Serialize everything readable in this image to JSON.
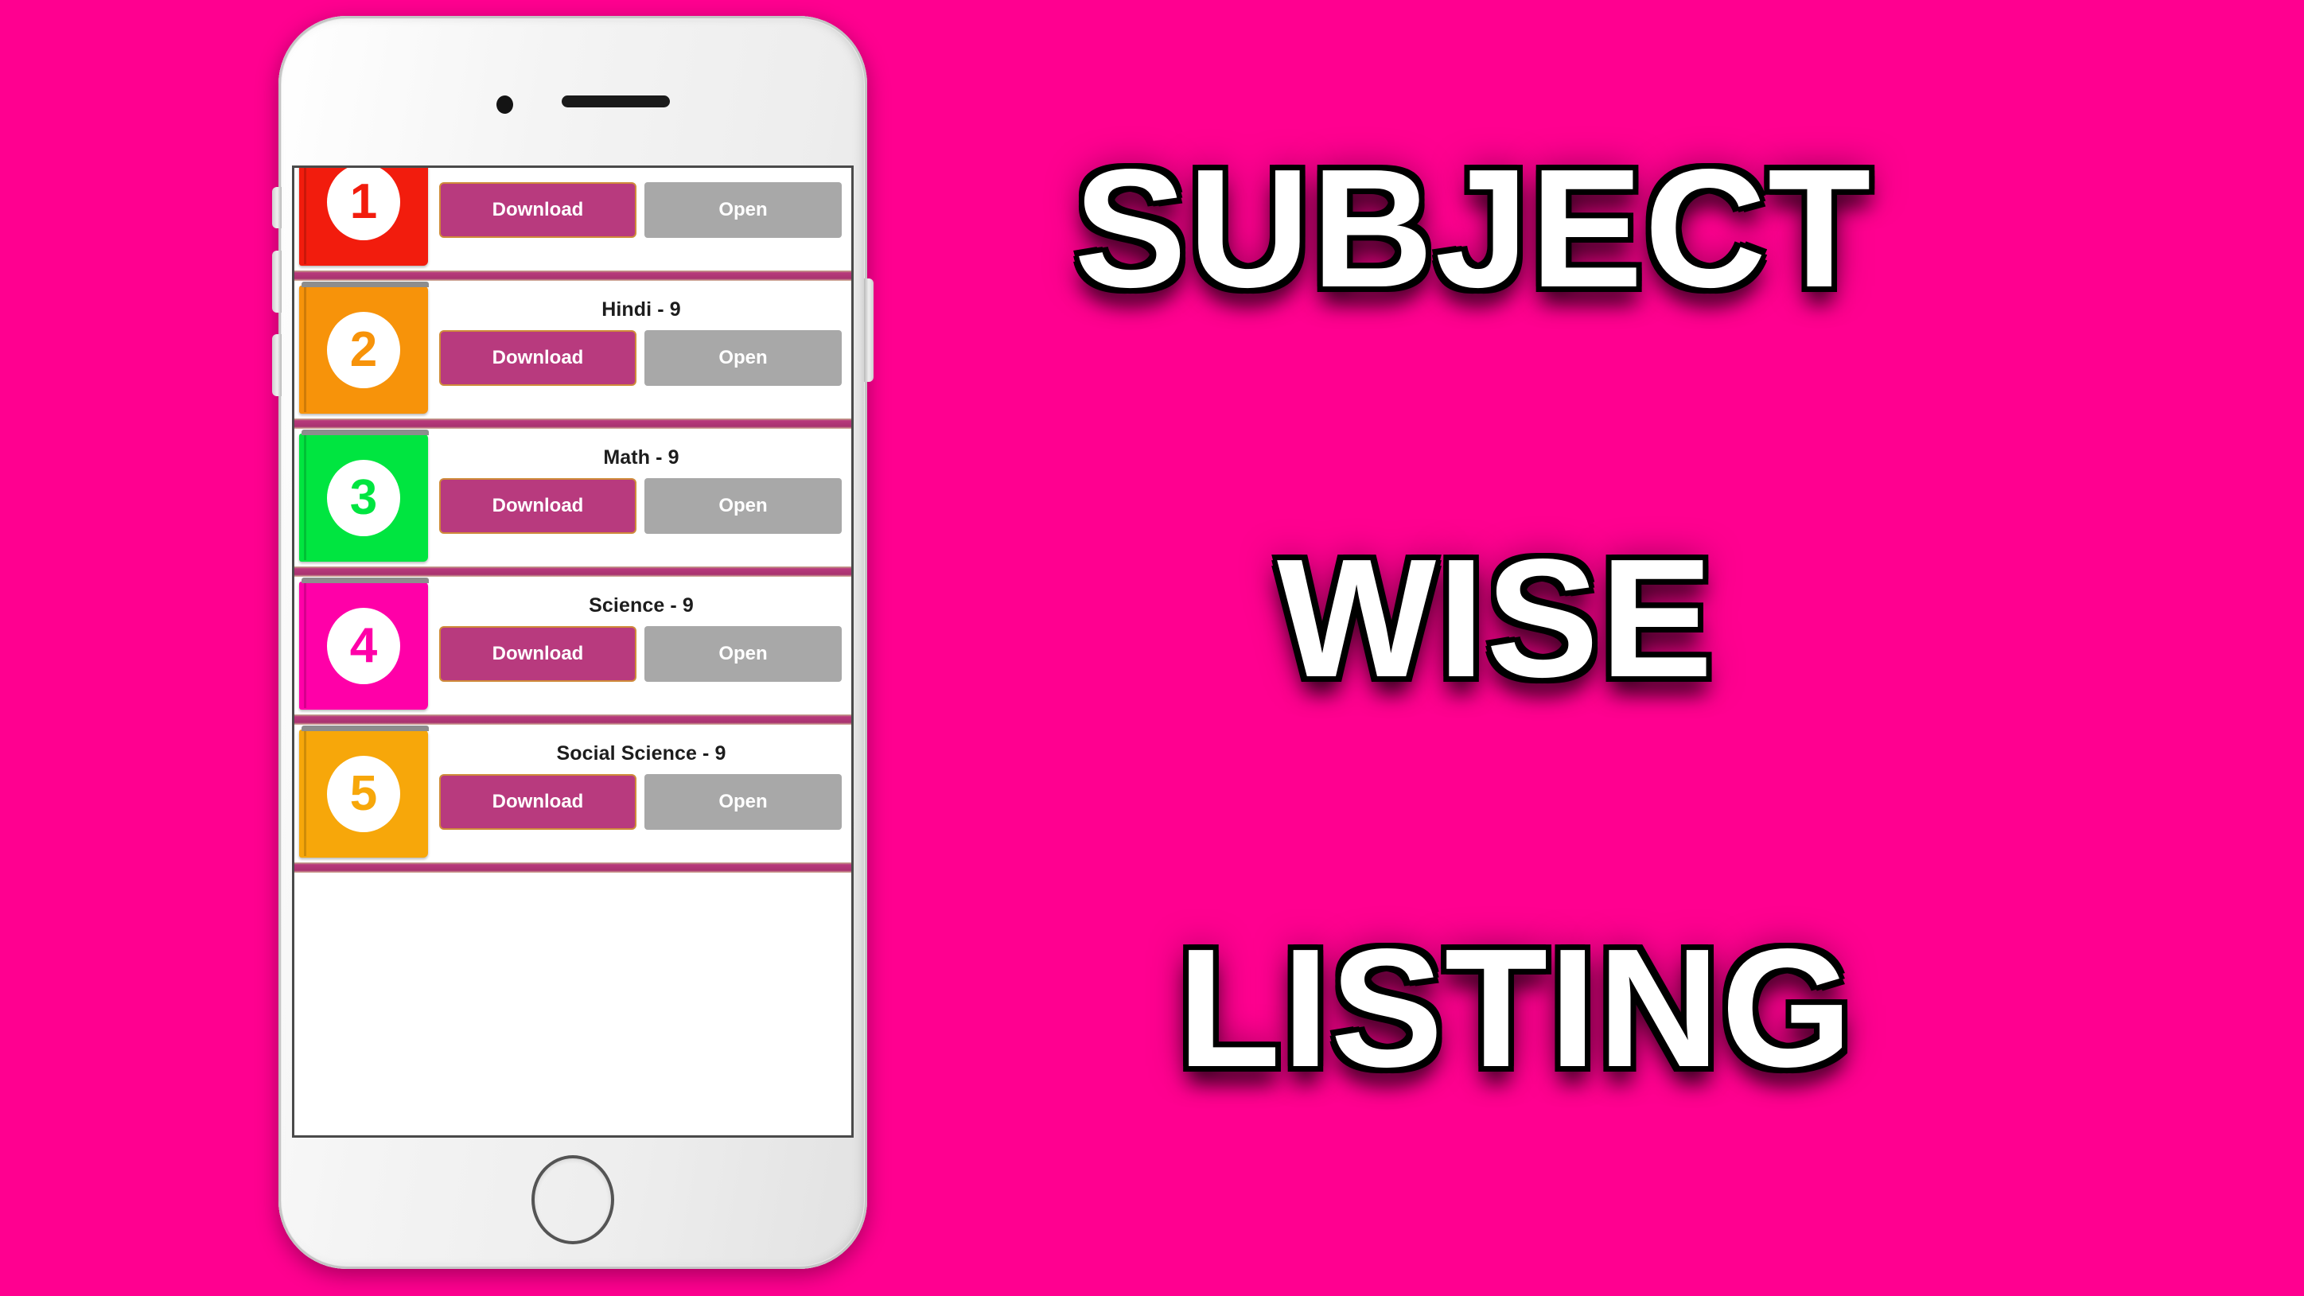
{
  "background": {
    "color": "#ff0090"
  },
  "headline": {
    "words": [
      {
        "text": "SUBJECT"
      },
      {
        "text": "WISE"
      },
      {
        "text": "LISTING"
      }
    ]
  },
  "phone": {
    "hardware": {
      "earpiece": "earpiece-speaker",
      "camera": "front-camera",
      "home_button": "home-button",
      "power_button": "power-button",
      "volume_up": "volume-up-button",
      "volume_down": "volume-down-button",
      "silent_switch": "silent-switch"
    }
  },
  "app": {
    "buttons": {
      "download_label": "Download",
      "open_label": "Open"
    },
    "colors": {
      "download_bg": "#b83a7e",
      "download_border": "#cf8b3a",
      "open_bg": "#a8a8a8",
      "divider": "#b8397c"
    },
    "list": [
      {
        "number": "1",
        "title": "",
        "book_color": "#f21c0d",
        "download_label": "Download",
        "open_label": "Open"
      },
      {
        "number": "2",
        "title": "Hindi - 9",
        "book_color": "#f7930a",
        "download_label": "Download",
        "open_label": "Open"
      },
      {
        "number": "3",
        "title": "Math - 9",
        "book_color": "#00e540",
        "download_label": "Download",
        "open_label": "Open"
      },
      {
        "number": "4",
        "title": "Science - 9",
        "book_color": "#ff00a8",
        "download_label": "Download",
        "open_label": "Open"
      },
      {
        "number": "5",
        "title": "Social Science - 9",
        "book_color": "#f7a70a",
        "download_label": "Download",
        "open_label": "Open"
      }
    ]
  }
}
